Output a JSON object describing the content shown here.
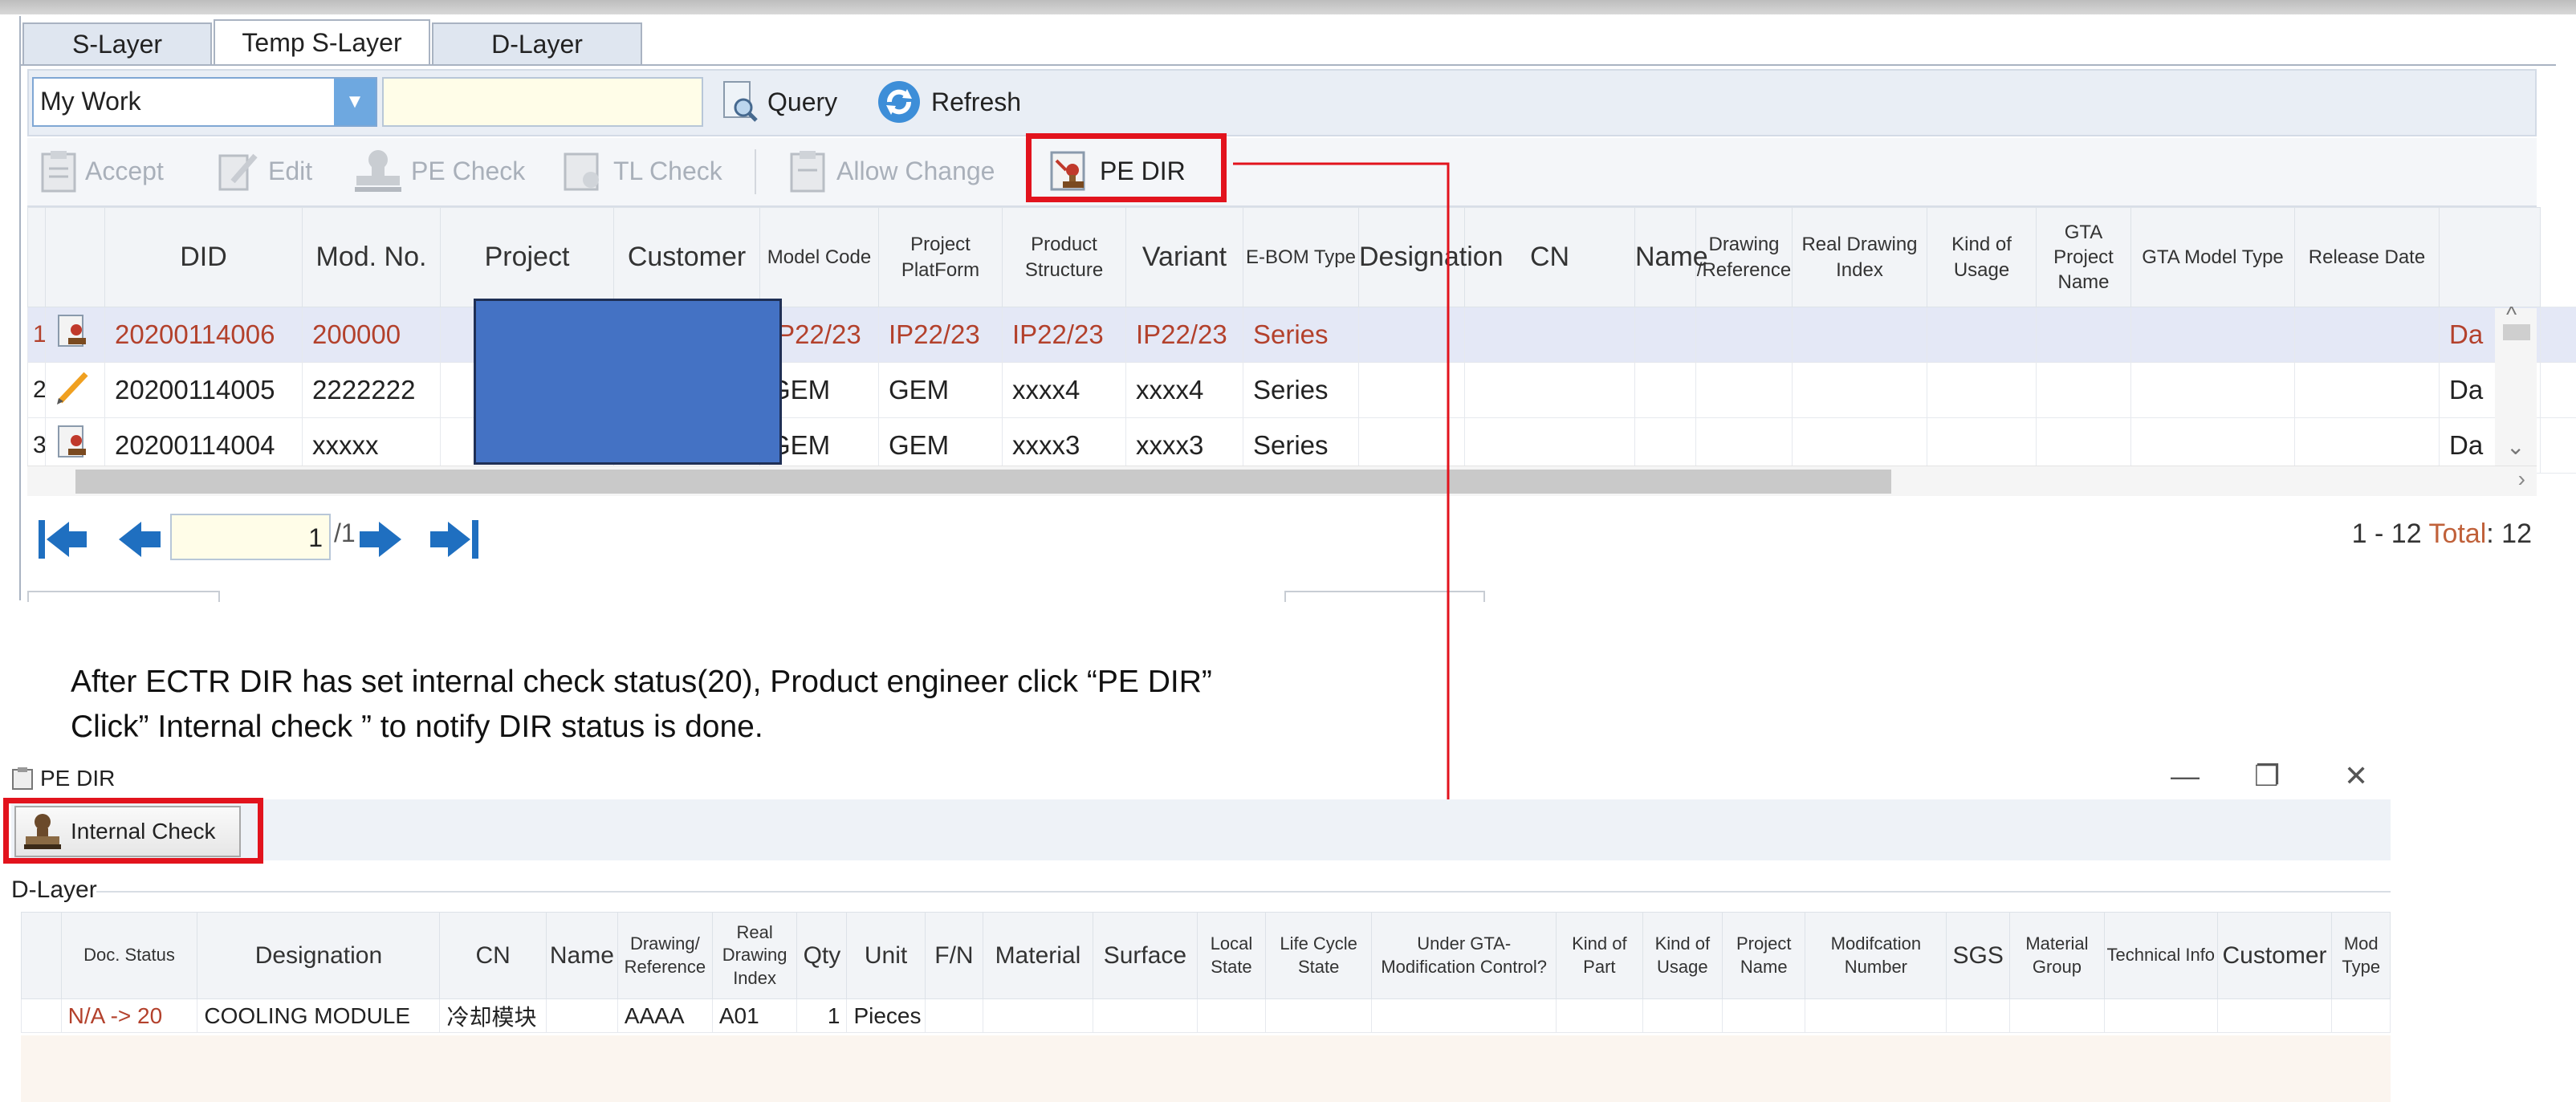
{
  "tabs": [
    "S-Layer",
    "Temp S-Layer",
    "D-Layer"
  ],
  "query": {
    "combo_value": "My Work",
    "query_label": "Query",
    "refresh_label": "Refresh"
  },
  "toolbar": {
    "accept": "Accept",
    "edit": "Edit",
    "pe_check": "PE Check",
    "tl_check": "TL Check",
    "allow_change": "Allow Change",
    "pe_dir": "PE DIR"
  },
  "grid": {
    "columns": [
      "DID",
      "Mod. No.",
      "Project",
      "Customer",
      "Model Code",
      "Project PlatForm",
      "Product Structure",
      "Variant",
      "E-BOM Type",
      "Designation",
      "CN",
      "Name",
      "Drawing /Reference",
      "Real Drawing Index",
      "Kind of Usage",
      "GTA Project Name",
      "GTA Model Type",
      "Release Date"
    ],
    "rows": [
      {
        "num": "1",
        "did": "20200114006",
        "mod": "200000",
        "model": "IP22/23",
        "platform": "IP22/23",
        "structure": "IP22/23",
        "variant": "IP22/23",
        "ebom": "Series",
        "date": "Da"
      },
      {
        "num": "2",
        "did": "20200114005",
        "mod": "2222222",
        "model": "GEM",
        "platform": "GEM",
        "structure": "xxxx4",
        "variant": "xxxx4",
        "ebom": "Series",
        "date": "Da"
      },
      {
        "num": "3",
        "did": "20200114004",
        "mod": "xxxxx",
        "model": "GEM",
        "platform": "GEM",
        "structure": "xxxx3",
        "variant": "xxxx3",
        "ebom": "Series",
        "date": "Da"
      }
    ]
  },
  "pager": {
    "page": "1",
    "total_pages": "/1",
    "range": "1 - 12",
    "total_label": "Total",
    "total": ": 12"
  },
  "annotation": {
    "line1": "After ECTR DIR has set internal check status(20), Product engineer click “PE DIR”",
    "line2": "Click” Internal check ”  to notify DIR status is done."
  },
  "dialog": {
    "title": "PE DIR",
    "internal_check": "Internal Check",
    "section": "D-Layer",
    "columns": [
      "Doc. Status",
      "Designation",
      "CN",
      "Name",
      "Drawing/ Reference",
      "Real Drawing Index",
      "Qty",
      "Unit",
      "F/N",
      "Material",
      "Surface",
      "Local State",
      "Life Cycle State",
      "Under GTA-Modification Control?",
      "Kind of Part",
      "Kind of Usage",
      "Project Name",
      "Modifcation Number",
      "SGS",
      "Material Group",
      "Technical Info",
      "Customer",
      "Mod Type"
    ],
    "row": {
      "status": "N/A -> 20",
      "designation": "COOLING MODULE",
      "cn": "冷却模块",
      "name": "",
      "drawing": "AAAA",
      "index": "A01",
      "qty": "1",
      "unit": "Pieces"
    }
  },
  "colors": {
    "highlight": "#e2131d",
    "redacted": "#4472c4",
    "selected_row": "#e4e8f6"
  }
}
